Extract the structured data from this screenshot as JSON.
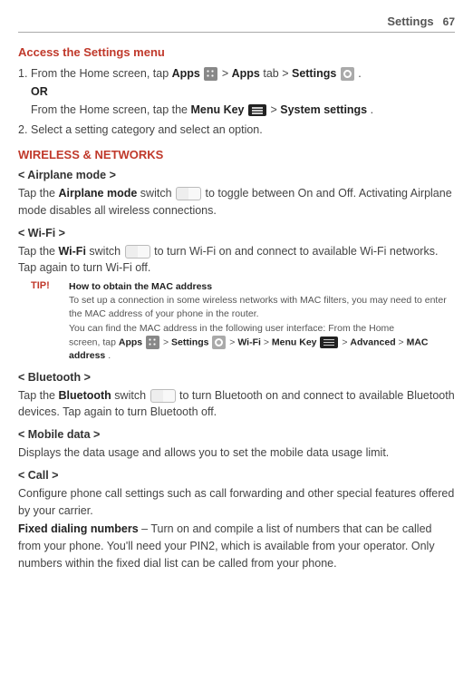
{
  "header": {
    "title": "Settings",
    "page": "67"
  },
  "access": {
    "heading": "Access the Settings menu",
    "step1_num": "1.",
    "step1_pre": "From the Home screen, tap ",
    "step1_apps": "Apps",
    "step1_mid1": " > ",
    "step1_appstab": "Apps",
    "step1_tab": " tab > ",
    "step1_settings": "Settings",
    "step1_end": " .",
    "or": "OR",
    "step1b_pre": "From the Home screen, tap the ",
    "step1b_menu": "Menu Key",
    "step1b_mid": " > ",
    "step1b_sys": "System settings",
    "step1b_end": ".",
    "step2_num": "2.",
    "step2": "Select a setting category and select an option."
  },
  "wireless": {
    "heading": "WIRELESS & NETWORKS",
    "airplane": {
      "heading": "< Airplane mode >",
      "pre": "Tap the ",
      "bold": "Airplane mode",
      "mid": " switch ",
      "post": " to toggle between On and Off. Activating Airplane mode disables all wireless connections."
    },
    "wifi": {
      "heading": "< Wi-Fi >",
      "pre": "Tap the ",
      "bold": "Wi-Fi",
      "mid": " switch ",
      "post": " to turn Wi-Fi on and connect to available Wi-Fi networks. Tap again to turn Wi-Fi off."
    },
    "tip": {
      "label": "TIP!",
      "title": "How to obtain the MAC address",
      "line1": "To set up a connection in some wireless networks with MAC filters, you may need to enter the MAC address of your phone in the router.",
      "line2": "You can find the MAC address in the following user interface: From the Home",
      "line3_pre": "screen, tap ",
      "apps": "Apps",
      "gt1": " > ",
      "settings": "Settings",
      "gt2": " > ",
      "wifitext": "Wi-Fi",
      "gt3": " > ",
      "menukey": "Menu Key",
      "gt4": " > ",
      "advanced": "Advanced",
      "gt5": " > ",
      "mac": "MAC address",
      "end": "."
    },
    "bluetooth": {
      "heading": "< Bluetooth >",
      "pre": "Tap the ",
      "bold": "Bluetooth",
      "mid": " switch ",
      "post": " to turn Bluetooth on and connect to available Bluetooth devices. Tap again to turn Bluetooth off."
    },
    "mobiledata": {
      "heading": "< Mobile data >",
      "text": "Displays the data usage and allows you to set the mobile data usage limit."
    },
    "call": {
      "heading": "< Call >",
      "text": "Configure phone call settings such as call forwarding and other special features offered by your carrier.",
      "fdn_bold": "Fixed dialing numbers",
      "fdn_rest": " – Turn on and compile a list of numbers that can be called from your phone. You'll need your PIN2, which is available from your operator. Only numbers within the fixed dial list can be called from your phone."
    }
  }
}
